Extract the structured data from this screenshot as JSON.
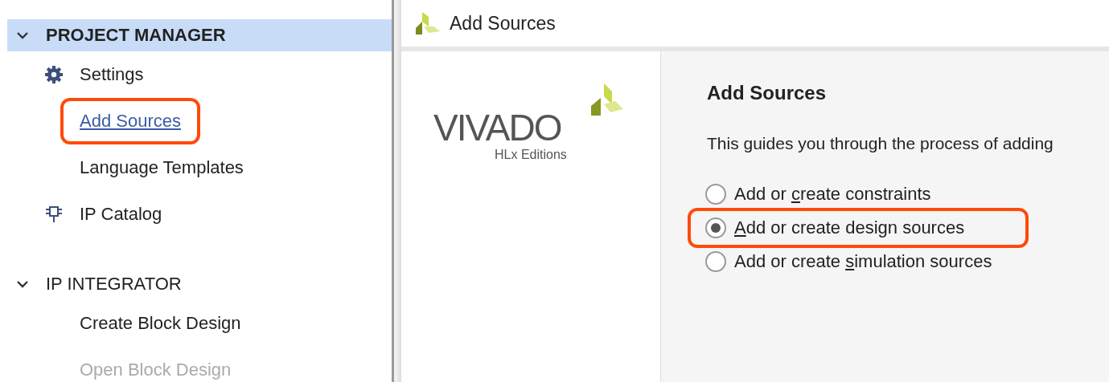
{
  "sidebar": {
    "sections": [
      {
        "title": "PROJECT MANAGER",
        "expanded": true,
        "selected": true,
        "children": [
          {
            "label": "Settings",
            "kind": "settings",
            "highlighted": false,
            "disabled": false
          },
          {
            "label": "Add Sources",
            "kind": "link",
            "highlighted": true,
            "disabled": false
          },
          {
            "label": "Language Templates",
            "kind": "plain",
            "highlighted": false,
            "disabled": false
          },
          {
            "label": "IP Catalog",
            "kind": "catalog",
            "highlighted": false,
            "disabled": false
          }
        ]
      },
      {
        "title": "IP INTEGRATOR",
        "expanded": true,
        "selected": false,
        "children": [
          {
            "label": "Create Block Design",
            "kind": "plain",
            "highlighted": false,
            "disabled": false
          },
          {
            "label": "Open Block Design",
            "kind": "plain",
            "highlighted": false,
            "disabled": true
          }
        ]
      }
    ]
  },
  "dialog": {
    "title": "Add Sources",
    "logo": {
      "wordmark": "VIVADO",
      "edition": "HLx Editions"
    },
    "heading": "Add Sources",
    "description": "This guides you through the process of adding",
    "options": [
      {
        "prefix": "Add or ",
        "key": "c",
        "rest": "reate constraints",
        "selected": false,
        "highlighted": false
      },
      {
        "key": "A",
        "rest": "dd or create design sources",
        "selected": true,
        "highlighted": true
      },
      {
        "prefix": "Add or create ",
        "key": "s",
        "rest": "imulation sources",
        "selected": false,
        "highlighted": false
      }
    ]
  }
}
